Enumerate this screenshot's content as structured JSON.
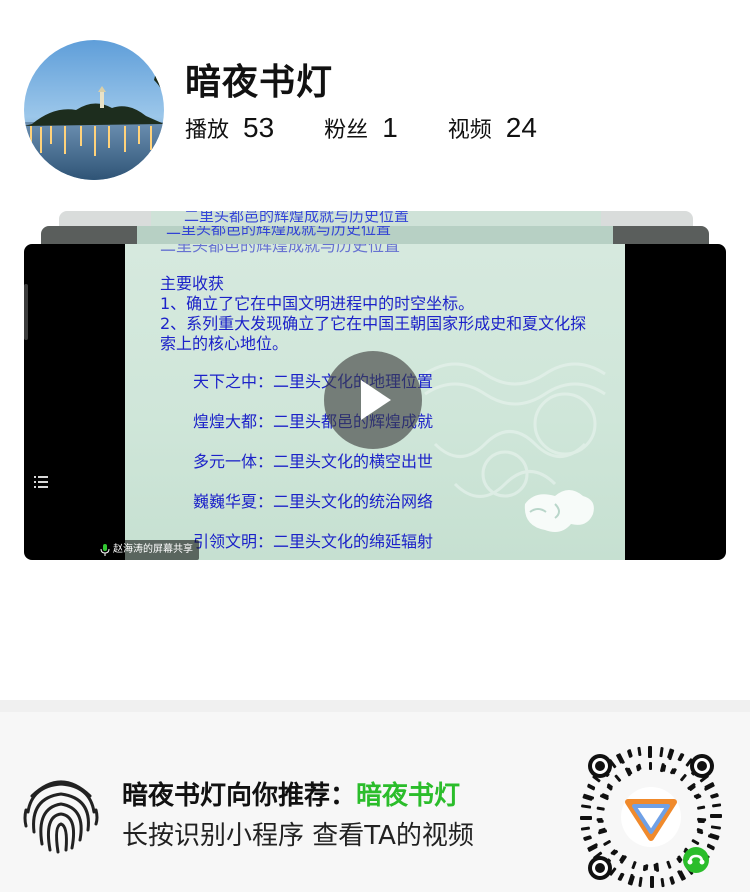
{
  "profile": {
    "name": "暗夜书灯",
    "stats": [
      {
        "label": "播放",
        "value": "53"
      },
      {
        "label": "粉丝",
        "value": "1"
      },
      {
        "label": "视频",
        "value": "24"
      }
    ]
  },
  "video": {
    "back_cards": [
      "二里头都邑的辉煌成就与历史位置",
      "二里头都邑的辉煌成就与历史位置"
    ],
    "slide": {
      "header_faded": "二里头都邑的辉煌成就与历史位置",
      "gains_title": "主要收获",
      "points": [
        "1、确立了它在中国文明进程中的时空坐标。",
        "2、系列重大发现确立了它在中国王朝国家形成史和夏文化探",
        "索上的核心地位。"
      ],
      "topics": [
        "天下之中：二里头文化的地理位置",
        "煌煌大都：二里头都邑的辉煌成就",
        "多元一体：二里头文化的横空出世",
        "巍巍华夏：二里头文化的统治网络",
        "引领文明：二里头文化的绵延辐射"
      ]
    },
    "share_badge": "赵海涛的屏幕共享",
    "play_icon": "play-icon",
    "list_icon": "list-icon"
  },
  "footer": {
    "recommend_prefix": "暗夜书灯向你推荐：",
    "recommend_highlight": "暗夜书灯",
    "hint": "长按识别小程序 查看TA的视频",
    "fingerprint_icon": "fingerprint-icon",
    "qr_icon": "mini-program-qrcode",
    "highlight_color": "#2bbd2b"
  }
}
